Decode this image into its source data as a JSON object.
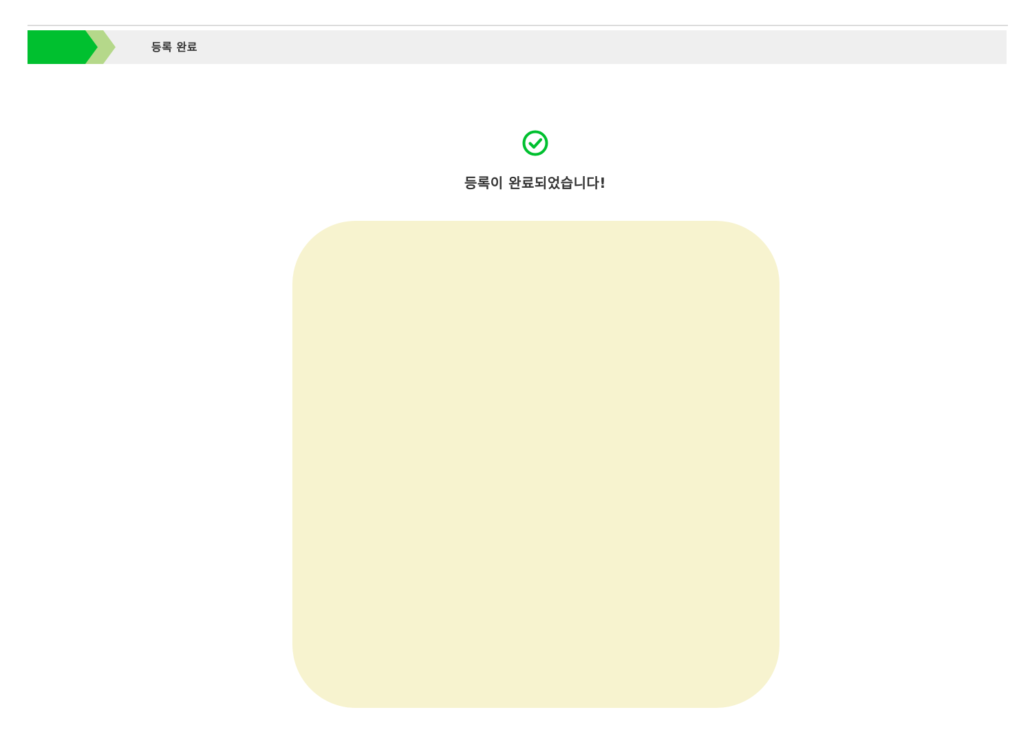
{
  "header": {
    "step_title": "등록 완료"
  },
  "result": {
    "icon": "check-circle-icon",
    "message": "등록이 완료되었습니다!"
  },
  "colors": {
    "accent_green": "#00c02f",
    "arrow_light_green": "#b5d88a",
    "bar_gray": "#efefef",
    "panel_yellow": "#f7f3cf"
  }
}
